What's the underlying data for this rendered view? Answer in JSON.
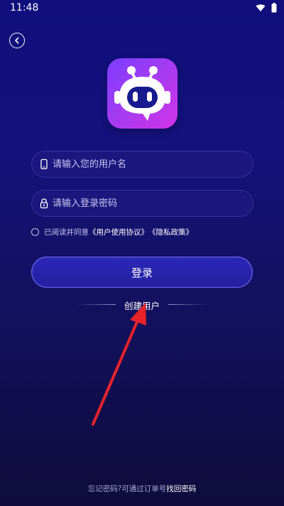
{
  "status_bar": {
    "time": "11:48",
    "icons": [
      "wifi-icon",
      "battery-icon"
    ]
  },
  "header": {
    "back_icon": "chevron-left-icon"
  },
  "logo": {
    "icon": "robot-icon"
  },
  "form": {
    "username": {
      "value": "",
      "placeholder": "请输入您的用户名",
      "icon": "phone-icon"
    },
    "password": {
      "value": "",
      "placeholder": "请输入登录密码",
      "icon": "lock-icon"
    },
    "agreement": {
      "prefix": "已阅读并同意",
      "user_agreement": "《用户使用协议》",
      "privacy_policy": "《隐私政策》"
    },
    "login_label": "登录",
    "create_user_label": "创建用户"
  },
  "footer": {
    "text": "忘记密码?可通过订单号",
    "link": "找回密码"
  },
  "colors": {
    "background_top": "#100f7d",
    "background_bottom": "#0f0b3c",
    "logo_gradient_start": "#7b3dff",
    "logo_gradient_end": "#d233e6",
    "annotation_arrow": "#e8232a"
  }
}
